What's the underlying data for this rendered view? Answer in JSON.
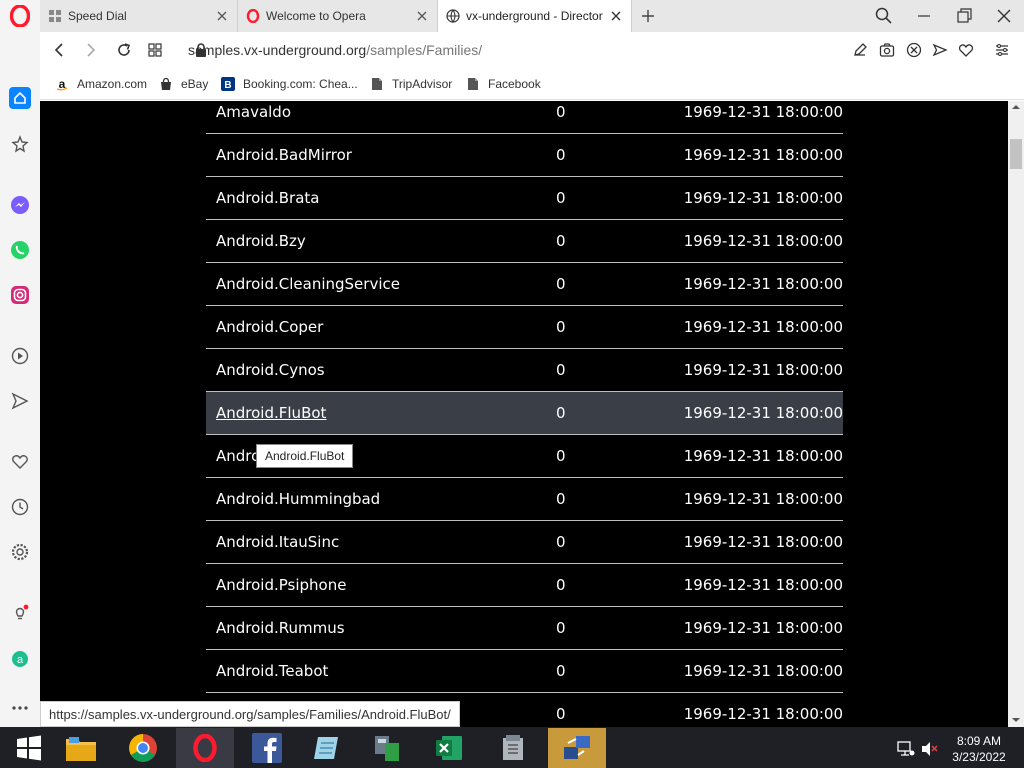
{
  "browser": {
    "tabs": [
      {
        "title": "Speed Dial"
      },
      {
        "title": "Welcome to Opera"
      },
      {
        "title": "vx-underground - Directory"
      }
    ],
    "url_host": "samples.vx-underground.org",
    "url_path": "/samples/Families/"
  },
  "bookmarks": [
    {
      "label": "Amazon.com",
      "icon": "amazon-icon"
    },
    {
      "label": "eBay",
      "icon": "ebay-icon"
    },
    {
      "label": "Booking.com: Chea...",
      "icon": "booking-icon"
    },
    {
      "label": "TripAdvisor",
      "icon": "page-icon"
    },
    {
      "label": "Facebook",
      "icon": "page-icon"
    }
  ],
  "listing": [
    {
      "name": "Amavaldo",
      "size": "0",
      "date": "1969-12-31 18:00:00"
    },
    {
      "name": "Android.BadMirror",
      "size": "0",
      "date": "1969-12-31 18:00:00"
    },
    {
      "name": "Android.Brata",
      "size": "0",
      "date": "1969-12-31 18:00:00"
    },
    {
      "name": "Android.Bzy",
      "size": "0",
      "date": "1969-12-31 18:00:00"
    },
    {
      "name": "Android.CleaningService",
      "size": "0",
      "date": "1969-12-31 18:00:00"
    },
    {
      "name": "Android.Coper",
      "size": "0",
      "date": "1969-12-31 18:00:00"
    },
    {
      "name": "Android.Cynos",
      "size": "0",
      "date": "1969-12-31 18:00:00"
    },
    {
      "name": "Android.FluBot",
      "size": "0",
      "date": "1969-12-31 18:00:00"
    },
    {
      "name": "Andro",
      "size": "0",
      "date": "1969-12-31 18:00:00"
    },
    {
      "name": "Android.Hummingbad",
      "size": "0",
      "date": "1969-12-31 18:00:00"
    },
    {
      "name": "Android.ItauSinc",
      "size": "0",
      "date": "1969-12-31 18:00:00"
    },
    {
      "name": "Android.Psiphone",
      "size": "0",
      "date": "1969-12-31 18:00:00"
    },
    {
      "name": "Android.Rummus",
      "size": "0",
      "date": "1969-12-31 18:00:00"
    },
    {
      "name": "Android.Teabot",
      "size": "0",
      "date": "1969-12-31 18:00:00"
    },
    {
      "name": "",
      "size": "0",
      "date": "1969-12-31 18:00:00"
    }
  ],
  "tooltip": "Android.FluBot",
  "status_url": "https://samples.vx-underground.org/samples/Families/Android.FluBot/",
  "clock": {
    "time": "8:09 AM",
    "date": "3/23/2022"
  },
  "colors": {
    "opera_red": "#ff1b2d",
    "accent_blue": "#0a84ff",
    "page_bg": "#000000",
    "highlight_row": "#3a3f47"
  }
}
